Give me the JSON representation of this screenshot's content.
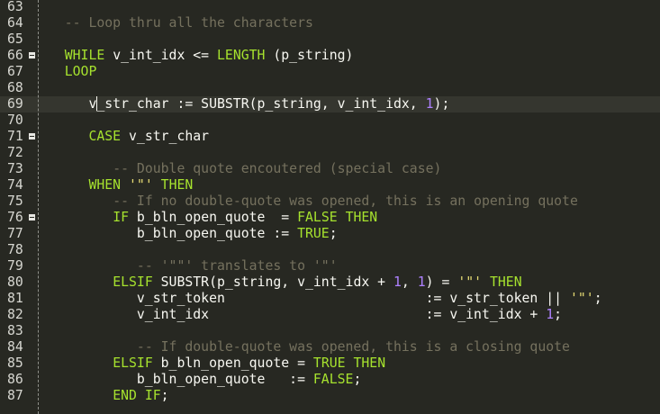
{
  "editor": {
    "cursor_line": "69",
    "lines": [
      {
        "n": "63",
        "fold": false,
        "tokens": []
      },
      {
        "n": "64",
        "fold": false,
        "tokens": [
          [
            "t",
            "   "
          ],
          [
            "cm",
            "-- Loop thru all the characters"
          ]
        ]
      },
      {
        "n": "65",
        "fold": false,
        "tokens": []
      },
      {
        "n": "66",
        "fold": true,
        "tokens": [
          [
            "t",
            "   "
          ],
          [
            "kw",
            "WHILE"
          ],
          [
            "t",
            " v_int_idx <= "
          ],
          [
            "kw",
            "LENGTH"
          ],
          [
            "t",
            " (p_string)"
          ]
        ]
      },
      {
        "n": "67",
        "fold": false,
        "tokens": [
          [
            "t",
            "   "
          ],
          [
            "kw",
            "LOOP"
          ]
        ]
      },
      {
        "n": "68",
        "fold": false,
        "tokens": []
      },
      {
        "n": "69",
        "fold": false,
        "tokens": [
          [
            "t",
            "      v"
          ],
          [
            "cursor",
            ""
          ],
          [
            "t",
            "_str_char := SUBSTR(p_string, v_int_idx, "
          ],
          [
            "num",
            "1"
          ],
          [
            "t",
            ");"
          ]
        ]
      },
      {
        "n": "70",
        "fold": false,
        "tokens": []
      },
      {
        "n": "71",
        "fold": true,
        "tokens": [
          [
            "t",
            "      "
          ],
          [
            "kw",
            "CASE"
          ],
          [
            "t",
            " v_str_char"
          ]
        ]
      },
      {
        "n": "72",
        "fold": false,
        "tokens": []
      },
      {
        "n": "73",
        "fold": false,
        "tokens": [
          [
            "t",
            "         "
          ],
          [
            "cm",
            "-- Double quote encoutered (special case)"
          ]
        ]
      },
      {
        "n": "74",
        "fold": false,
        "tokens": [
          [
            "t",
            "      "
          ],
          [
            "kw",
            "WHEN"
          ],
          [
            "t",
            " "
          ],
          [
            "str",
            "'\"'"
          ],
          [
            "t",
            " "
          ],
          [
            "kw",
            "THEN"
          ]
        ]
      },
      {
        "n": "75",
        "fold": false,
        "tokens": [
          [
            "t",
            "         "
          ],
          [
            "cm",
            "-- If no double-quote was opened, this is an opening quote"
          ]
        ]
      },
      {
        "n": "76",
        "fold": true,
        "tokens": [
          [
            "t",
            "         "
          ],
          [
            "kw",
            "IF"
          ],
          [
            "t",
            " b_bln_open_quote  = "
          ],
          [
            "kw",
            "FALSE"
          ],
          [
            "t",
            " "
          ],
          [
            "kw",
            "THEN"
          ]
        ]
      },
      {
        "n": "77",
        "fold": false,
        "tokens": [
          [
            "t",
            "            b_bln_open_quote := "
          ],
          [
            "kw",
            "TRUE"
          ],
          [
            "t",
            ";"
          ]
        ]
      },
      {
        "n": "78",
        "fold": false,
        "tokens": []
      },
      {
        "n": "79",
        "fold": false,
        "tokens": [
          [
            "t",
            "            "
          ],
          [
            "cm",
            "-- '\"\"' translates to '\"'"
          ]
        ]
      },
      {
        "n": "80",
        "fold": false,
        "tokens": [
          [
            "t",
            "         "
          ],
          [
            "kw",
            "ELSIF"
          ],
          [
            "t",
            " SUBSTR(p_string, v_int_idx + "
          ],
          [
            "num",
            "1"
          ],
          [
            "t",
            ", "
          ],
          [
            "num",
            "1"
          ],
          [
            "t",
            ") = "
          ],
          [
            "str",
            "'\"'"
          ],
          [
            "t",
            " "
          ],
          [
            "kw",
            "THEN"
          ]
        ]
      },
      {
        "n": "81",
        "fold": false,
        "tokens": [
          [
            "t",
            "            v_str_token                         := v_str_token || "
          ],
          [
            "str",
            "'\"'"
          ],
          [
            "t",
            ";"
          ]
        ]
      },
      {
        "n": "82",
        "fold": false,
        "tokens": [
          [
            "t",
            "            v_int_idx                           := v_int_idx + "
          ],
          [
            "num",
            "1"
          ],
          [
            "t",
            ";"
          ]
        ]
      },
      {
        "n": "83",
        "fold": false,
        "tokens": []
      },
      {
        "n": "84",
        "fold": false,
        "tokens": [
          [
            "t",
            "            "
          ],
          [
            "cm",
            "-- If double-quote was opened, this is a closing quote"
          ]
        ]
      },
      {
        "n": "85",
        "fold": false,
        "tokens": [
          [
            "t",
            "         "
          ],
          [
            "kw",
            "ELSIF"
          ],
          [
            "t",
            " b_bln_open_quote = "
          ],
          [
            "kw",
            "TRUE"
          ],
          [
            "t",
            " "
          ],
          [
            "kw",
            "THEN"
          ]
        ]
      },
      {
        "n": "86",
        "fold": false,
        "tokens": [
          [
            "t",
            "            b_bln_open_quote   := "
          ],
          [
            "kw",
            "FALSE"
          ],
          [
            "t",
            ";"
          ]
        ]
      },
      {
        "n": "87",
        "fold": false,
        "tokens": [
          [
            "t",
            "         "
          ],
          [
            "kw",
            "END"
          ],
          [
            "t",
            " "
          ],
          [
            "kw",
            "IF"
          ],
          [
            "t",
            ";"
          ]
        ]
      }
    ]
  }
}
